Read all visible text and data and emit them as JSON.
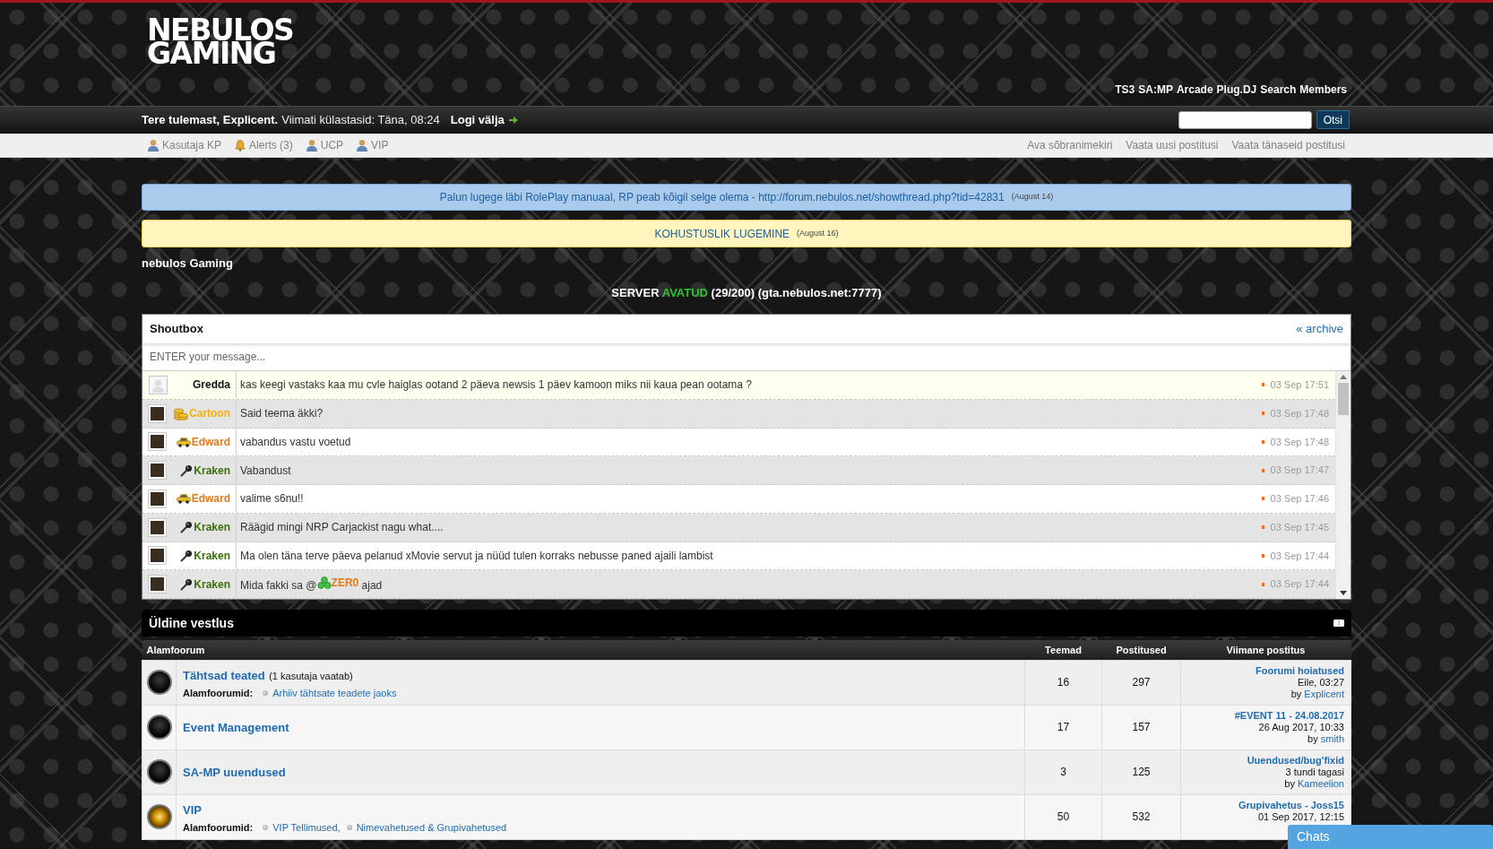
{
  "header": {
    "logo_lines": [
      "NEBULOS",
      "GAMING"
    ],
    "top_links": [
      "TS3",
      "SA:MP",
      "Arcade",
      "Plug.DJ",
      "Search",
      "Members"
    ]
  },
  "welcome_bar": {
    "greeting": "Tere tulemast, Explicent.",
    "last_visit": "Viimati külastasid: Täna, 08:24",
    "logout": "Logi välja",
    "search_button": "Otsi"
  },
  "user_nav": {
    "left": [
      {
        "label": "Kasutaja KP",
        "kind": "user"
      },
      {
        "label": "Alerts (3)",
        "kind": "bell"
      },
      {
        "label": "UCP",
        "kind": "user"
      },
      {
        "label": "VIP",
        "kind": "user"
      }
    ],
    "right": [
      "Ava sõbranimekiri",
      "Vaata uusi postitusi",
      "Vaata tänaseid postitusi"
    ]
  },
  "announcements": [
    {
      "kind": "info",
      "text": "Palun lugege läbi RolePlay manuaal, RP peab kõigil selge olema - http://forum.nebulos.net/showthread.php?tid=42831",
      "date": "(August 14)"
    },
    {
      "kind": "warning",
      "text": "KOHUSTUSLIK LUGEMINE",
      "date": "(August 16)"
    }
  ],
  "site_title": "nebulos Gaming",
  "server_status": {
    "label": "SERVER",
    "state": "AVATUD",
    "online": true,
    "players": "(29/200)",
    "address": "(gta.nebulos.net:7777)"
  },
  "shoutbox": {
    "title": "Shoutbox",
    "archive_link": "« archive",
    "placeholder": "ENTER your message...",
    "shouts": [
      {
        "author": "Gredda",
        "color": "#111111",
        "avatar": {
          "kind": "default"
        },
        "highlighted": true,
        "message": "kas keegi vastaks kaa mu cvle haiglas ootand 2 päeva newsis 1 päev kamoon miks nii kaua pean ootama ?",
        "time": "03 Sep 17:51"
      },
      {
        "author": "Cartoon",
        "color": "#f2b20c",
        "avatar": {
          "kind": "photo"
        },
        "badge": {
          "kind": "coins"
        },
        "highlighted": false,
        "message": "Said teema äkki?",
        "time": "03 Sep 17:48"
      },
      {
        "author": "Edward",
        "color": "#e27a1c",
        "avatar": {
          "kind": "photo"
        },
        "badge": {
          "kind": "car"
        },
        "highlighted": false,
        "message": "vabandus vastu voetud",
        "time": "03 Sep 17:48"
      },
      {
        "author": "Kraken",
        "color": "#3c6e0c",
        "avatar": {
          "kind": "photo"
        },
        "badge": {
          "kind": "microphone"
        },
        "highlighted": false,
        "message": "Vabandust",
        "time": "03 Sep 17:47"
      },
      {
        "author": "Edward",
        "color": "#e27a1c",
        "avatar": {
          "kind": "photo"
        },
        "badge": {
          "kind": "car"
        },
        "highlighted": false,
        "message": "valime s6nu!!",
        "time": "03 Sep 17:46"
      },
      {
        "author": "Kraken",
        "color": "#3c6e0c",
        "avatar": {
          "kind": "photo"
        },
        "badge": {
          "kind": "microphone"
        },
        "highlighted": false,
        "message": "Räägid mingi NRP Carjackist nagu what....",
        "time": "03 Sep 17:45"
      },
      {
        "author": "Kraken",
        "color": "#3c6e0c",
        "avatar": {
          "kind": "photo"
        },
        "badge": {
          "kind": "microphone"
        },
        "highlighted": false,
        "message": "Ma olen täna terve päeva pelanud xMovie servut ja nüüd tulen korraks nebusse paned ajaili lambist",
        "time": "03 Sep 17:44"
      },
      {
        "author": "Kraken",
        "color": "#3c6e0c",
        "avatar": {
          "kind": "photo"
        },
        "badge": {
          "kind": "microphone"
        },
        "highlighted": false,
        "message": "Mida fakki sa @",
        "mention": {
          "name": "ZER0",
          "color": "#e27a1c",
          "badge": {
            "kind": "clover"
          }
        },
        "message_end": " ajad",
        "time": "03 Sep 17:44"
      }
    ]
  },
  "forum_category": {
    "title": "Üldine vestlus",
    "columns": [
      "Alamfoorum",
      "Teemad",
      "Postitused",
      "Viimane postitus"
    ],
    "forums": [
      {
        "title": "Tähtsad teated",
        "viewers": "(1 kasutaja vaatab)",
        "has_new": false,
        "subforums_label": "Alamfoorumid:",
        "subforums": [
          "Arhiiv tähtsate teadete jaoks"
        ],
        "threads": "16",
        "posts": "297",
        "last_post": {
          "title": "Foorumi hoiatused",
          "time": "Eile, 03:27",
          "by": "by",
          "author": "Explicent"
        }
      },
      {
        "title": "Event Management",
        "has_new": false,
        "threads": "17",
        "posts": "157",
        "last_post": {
          "title": "#EVENT 11 - 24.08.2017",
          "time": "26 Aug 2017, 10:33",
          "by": "by",
          "author": "smith"
        }
      },
      {
        "title": "SA-MP uuendused",
        "has_new": false,
        "threads": "3",
        "posts": "125",
        "last_post": {
          "title": "Uuendused/bug'fixid",
          "time": "3 tundi tagasi",
          "by": "by",
          "author": "Kameelion"
        }
      },
      {
        "title": "VIP",
        "has_new": true,
        "subforums_label": "Alamfoorumid:",
        "subforums": [
          "VIP Tellimused,",
          "Nimevahetused & Grupivahetused"
        ],
        "threads": "50",
        "posts": "532",
        "last_post": {
          "title": "Grupivahetus - Joss15",
          "time": "01 Sep 2017, 12:15"
        }
      }
    ]
  },
  "chat_tab": {
    "label": "Chats"
  }
}
